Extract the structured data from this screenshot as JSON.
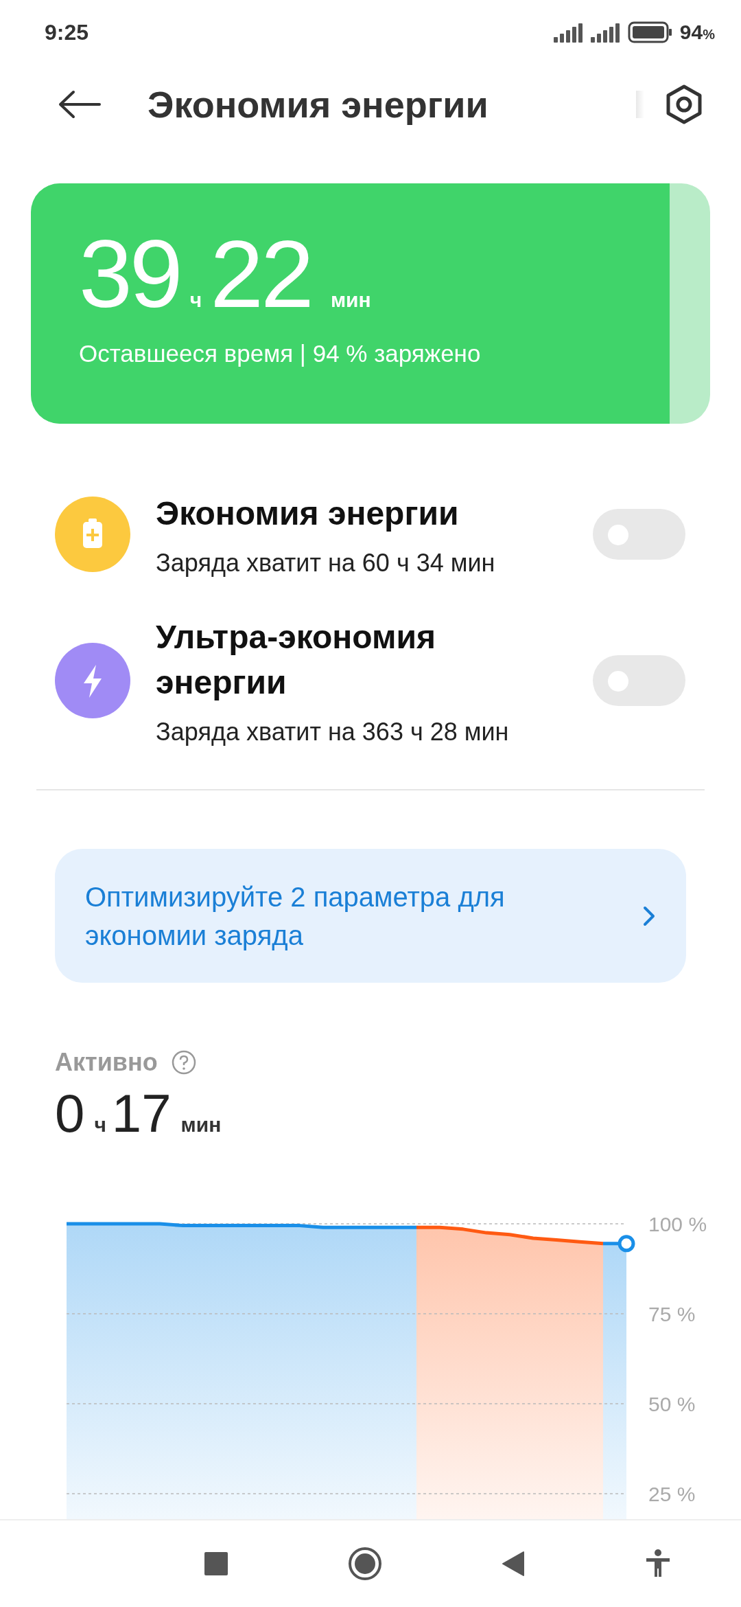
{
  "status_bar": {
    "time": "9:25",
    "battery": "94",
    "battery_unit": "%"
  },
  "header": {
    "title": "Экономия энергии"
  },
  "battery_card": {
    "hours": "39",
    "hours_unit": "ч",
    "minutes": "22",
    "minutes_unit": "мин",
    "subtitle": "Оставшееся время | 94 % заряжено",
    "level": 0.94
  },
  "modes": [
    {
      "kind": "battery",
      "color": "#fcc93f",
      "title": "Экономия энергии",
      "subtitle": "Заряда хватит на 60 ч 34 мин",
      "on": false
    },
    {
      "kind": "bolt",
      "color": "#a08bf5",
      "title": "Ультра-экономия энергии",
      "subtitle": "Заряда хватит на 363 ч 28 мин",
      "on": false
    }
  ],
  "banner": {
    "text": "Оптимизируйте 2 параметра для экономии заряда"
  },
  "activity": {
    "label": "Активно",
    "hours": "0",
    "hours_unit": "ч",
    "minutes": "17",
    "minutes_unit": "мин",
    "chart_data": {
      "type": "area",
      "grid": true,
      "series": [
        {
          "color": "#1a8fe8",
          "values": [
            100,
            100,
            100,
            100,
            100,
            99.5,
            99.5,
            99.5,
            99.5,
            99.5,
            99.5,
            99,
            99,
            99,
            99,
            99,
            null,
            null,
            null,
            null,
            null,
            null,
            null,
            null,
            null
          ]
        },
        {
          "color": "#ff5a12",
          "values": [
            null,
            null,
            null,
            null,
            null,
            null,
            null,
            null,
            null,
            null,
            null,
            null,
            null,
            null,
            null,
            99,
            99,
            98.5,
            97.5,
            97,
            96,
            95.5,
            95,
            94.5,
            null
          ]
        },
        {
          "color": "#1a8fe8",
          "values": [
            null,
            null,
            null,
            null,
            null,
            null,
            null,
            null,
            null,
            null,
            null,
            null,
            null,
            null,
            null,
            null,
            null,
            null,
            null,
            null,
            null,
            null,
            null,
            94.5,
            94.5
          ]
        }
      ],
      "ylim": [
        0,
        100
      ],
      "yticks": [
        {
          "value": 100,
          "label": "100 %"
        },
        {
          "value": 75,
          "label": "75 %"
        },
        {
          "value": 50,
          "label": "50 %"
        },
        {
          "value": 25,
          "label": "25 %"
        }
      ]
    }
  }
}
